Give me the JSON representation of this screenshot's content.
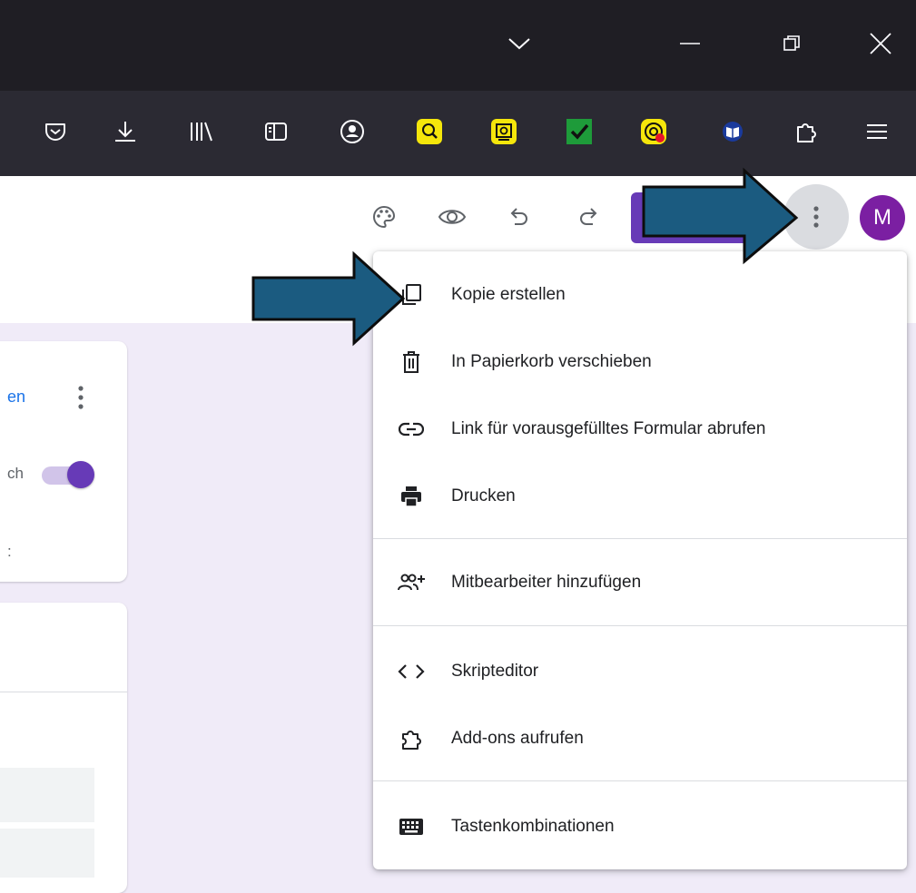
{
  "avatar": {
    "letter": "M"
  },
  "card1": {
    "title_fragment": "en",
    "toggle_label_fragment": "ch",
    "extra_fragment": ":"
  },
  "menu": {
    "items": [
      {
        "label": "Kopie erstellen",
        "icon": "copy-icon"
      },
      {
        "label": "In Papierkorb verschieben",
        "icon": "trash-icon"
      },
      {
        "label": "Link für vorausgefülltes Formular abrufen",
        "icon": "link-icon"
      },
      {
        "label": "Drucken",
        "icon": "print-icon"
      },
      {
        "label": "Mitbearbeiter hinzufügen",
        "icon": "add-people-icon"
      },
      {
        "label": "Skripteditor",
        "icon": "code-icon"
      },
      {
        "label": "Add-ons aufrufen",
        "icon": "puzzle-icon"
      },
      {
        "label": "Tastenkombinationen",
        "icon": "keyboard-icon"
      }
    ]
  },
  "colors": {
    "accent": "#673ab7",
    "avatar": "#7b1fa2",
    "arrow": "#1b5b80",
    "page_background": "#f0ebf8"
  }
}
